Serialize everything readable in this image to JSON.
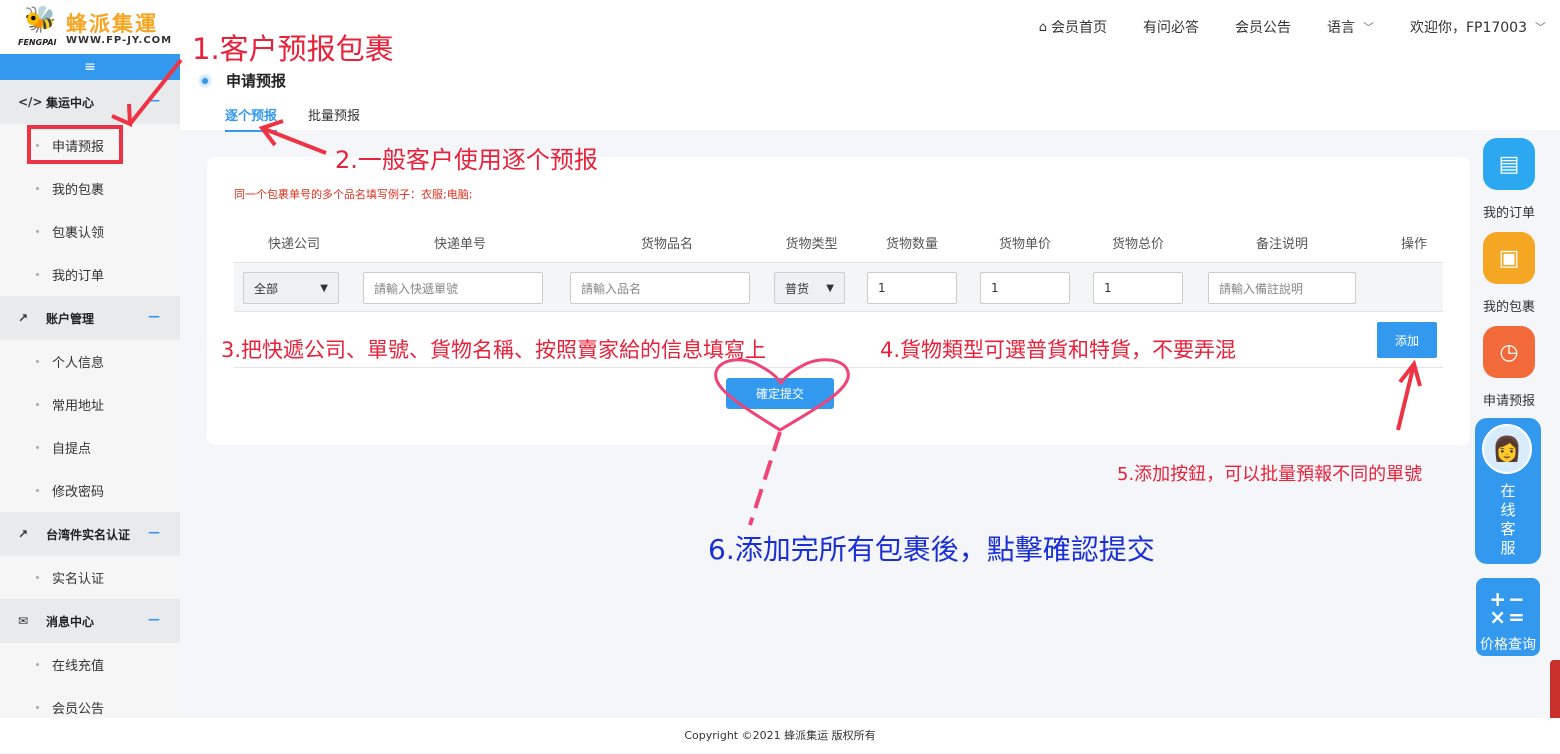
{
  "header": {
    "logo_cn": "蜂派集運",
    "logo_url": "WWW.FP-JY.COM",
    "logo_sub": "FENGPAI",
    "nav": [
      {
        "label": "会员首页",
        "icon": "home-icon"
      },
      {
        "label": "有问必答"
      },
      {
        "label": "会员公告"
      },
      {
        "label": "语言",
        "dropdown": true
      },
      {
        "label": "欢迎你，FP17003",
        "dropdown": true
      }
    ]
  },
  "sidebar": {
    "toggle_icon": "menu-icon",
    "groups": [
      {
        "label": "集运中心",
        "icon": "code-icon",
        "items": [
          "申请预报",
          "我的包裹",
          "包裹认领",
          "我的订单"
        ]
      },
      {
        "label": "账户管理",
        "icon": "chart-icon",
        "items": [
          "个人信息",
          "常用地址",
          "自提点",
          "修改密码"
        ]
      },
      {
        "label": "台湾件实名认证",
        "icon": "chart-icon",
        "items": [
          "实名认证"
        ]
      },
      {
        "label": "消息中心",
        "icon": "mail-icon",
        "items": [
          "在线充值",
          "会员公告"
        ]
      }
    ]
  },
  "page": {
    "title": "申请预报",
    "tabs": [
      "逐个预报",
      "批量预报"
    ],
    "active_tab": "逐个预报"
  },
  "form": {
    "hint": "同一个包裹单号的多个品名填写例子：衣服;电脑;",
    "columns": [
      "快递公司",
      "快递单号",
      "货物品名",
      "货物类型",
      "货物数量",
      "货物单价",
      "货物总价",
      "备注说明",
      "操作"
    ],
    "row": {
      "courier": "全部",
      "tracking_placeholder": "請輸入快遞單號",
      "product_placeholder": "請輸入品名",
      "type": "普货",
      "quantity": "1",
      "unit_price": "1",
      "total_price": "1",
      "note_placeholder": "請輸入備註說明"
    },
    "add_label": "添加",
    "submit_label": "確定提交"
  },
  "quick": {
    "orders": "我的订单",
    "packages": "我的包裹",
    "forecast": "申请预报",
    "service": "在线客服",
    "price": "价格查询"
  },
  "footer": "Copyright ©2021 蜂派集运 版权所有",
  "annotations": {
    "a1": "1.客户预报包裹",
    "a2": "2.一般客户使用逐个预报",
    "a3": "3.把快遞公司、單號、貨物名稱、按照賣家給的信息填寫上",
    "a4": "4.貨物類型可選普貨和特貨，不要弄混",
    "a5": "5.添加按鈕，可以批量預報不同的單號",
    "a6": "6.添加完所有包裹後，點擊確認提交"
  },
  "colors": {
    "accent": "#3399ee",
    "annotation_red": "#e8223a",
    "annotation_blue": "#1a2fd6",
    "logo_gold": "#f5a623"
  }
}
